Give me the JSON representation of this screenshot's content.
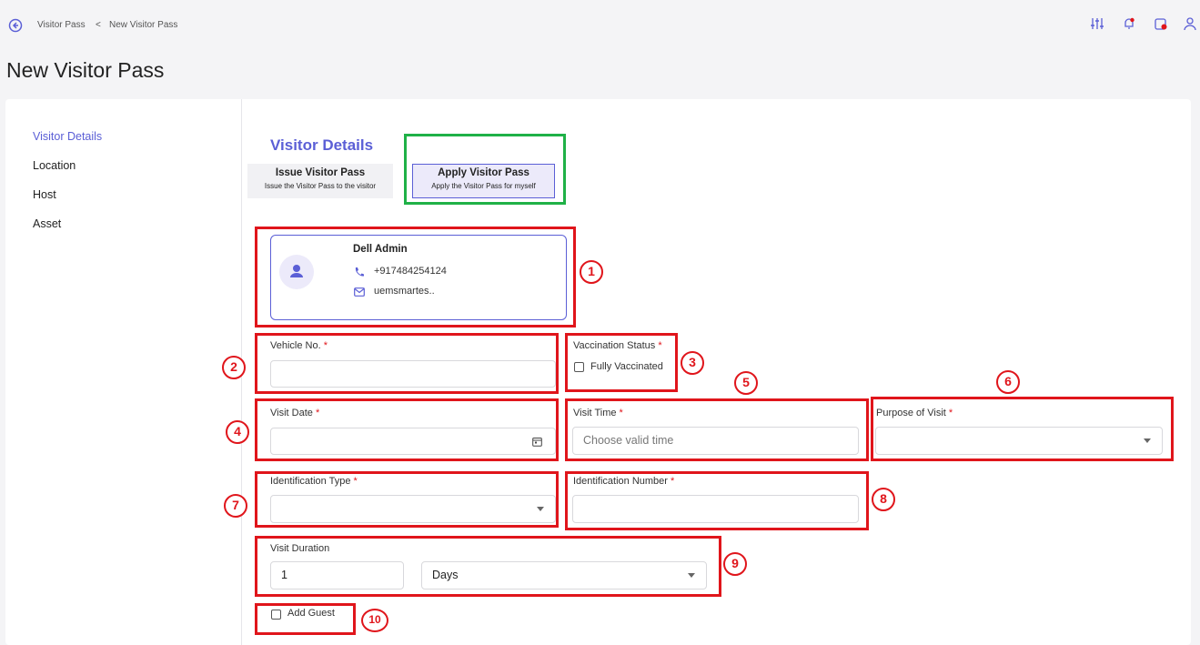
{
  "breadcrumb": {
    "parent": "Visitor Pass",
    "separator": "<",
    "current": "New Visitor Pass"
  },
  "page_title": "New Visitor Pass",
  "sidebar": {
    "items": [
      {
        "label": "Visitor Details",
        "active": true
      },
      {
        "label": "Location"
      },
      {
        "label": "Host"
      },
      {
        "label": "Asset"
      }
    ]
  },
  "section_title": "Visitor Details",
  "tabs": [
    {
      "title": "Issue Visitor Pass",
      "subtitle": "Issue the Visitor Pass to the visitor"
    },
    {
      "title": "Apply Visitor Pass",
      "subtitle": "Apply the Visitor Pass for myself",
      "selected": true
    }
  ],
  "profile": {
    "name": "Dell Admin",
    "phone": "+917484254124",
    "email": "uemsmartes.."
  },
  "fields": {
    "vehicle_no": {
      "label": "Vehicle No.",
      "required_mark": "*",
      "value": ""
    },
    "vaccination_status": {
      "label": "Vaccination Status",
      "required_mark": "*",
      "option": "Fully Vaccinated",
      "checked": false
    },
    "visit_date": {
      "label": "Visit Date",
      "required_mark": "*",
      "value": ""
    },
    "visit_time": {
      "label": "Visit Time",
      "required_mark": "*",
      "placeholder": "Choose valid time"
    },
    "purpose_of_visit": {
      "label": "Purpose of Visit",
      "required_mark": "*",
      "value": ""
    },
    "identification_type": {
      "label": "Identification Type",
      "required_mark": "*",
      "value": ""
    },
    "identification_number": {
      "label": "Identification Number",
      "required_mark": "*",
      "value": ""
    },
    "visit_duration": {
      "label": "Visit Duration",
      "value": "1",
      "unit": "Days"
    },
    "add_guest": {
      "label": "Add Guest",
      "checked": false
    }
  },
  "annotations": [
    "1",
    "2",
    "3",
    "4",
    "5",
    "6",
    "7",
    "8",
    "9",
    "10"
  ],
  "colors": {
    "accent": "#5b5fd6",
    "annotation_red": "#e0151b",
    "annotation_green": "#1fb147"
  },
  "top_icons": [
    "sliders-icon",
    "notification-bell-icon",
    "calendar-alert-icon",
    "user-icon"
  ]
}
